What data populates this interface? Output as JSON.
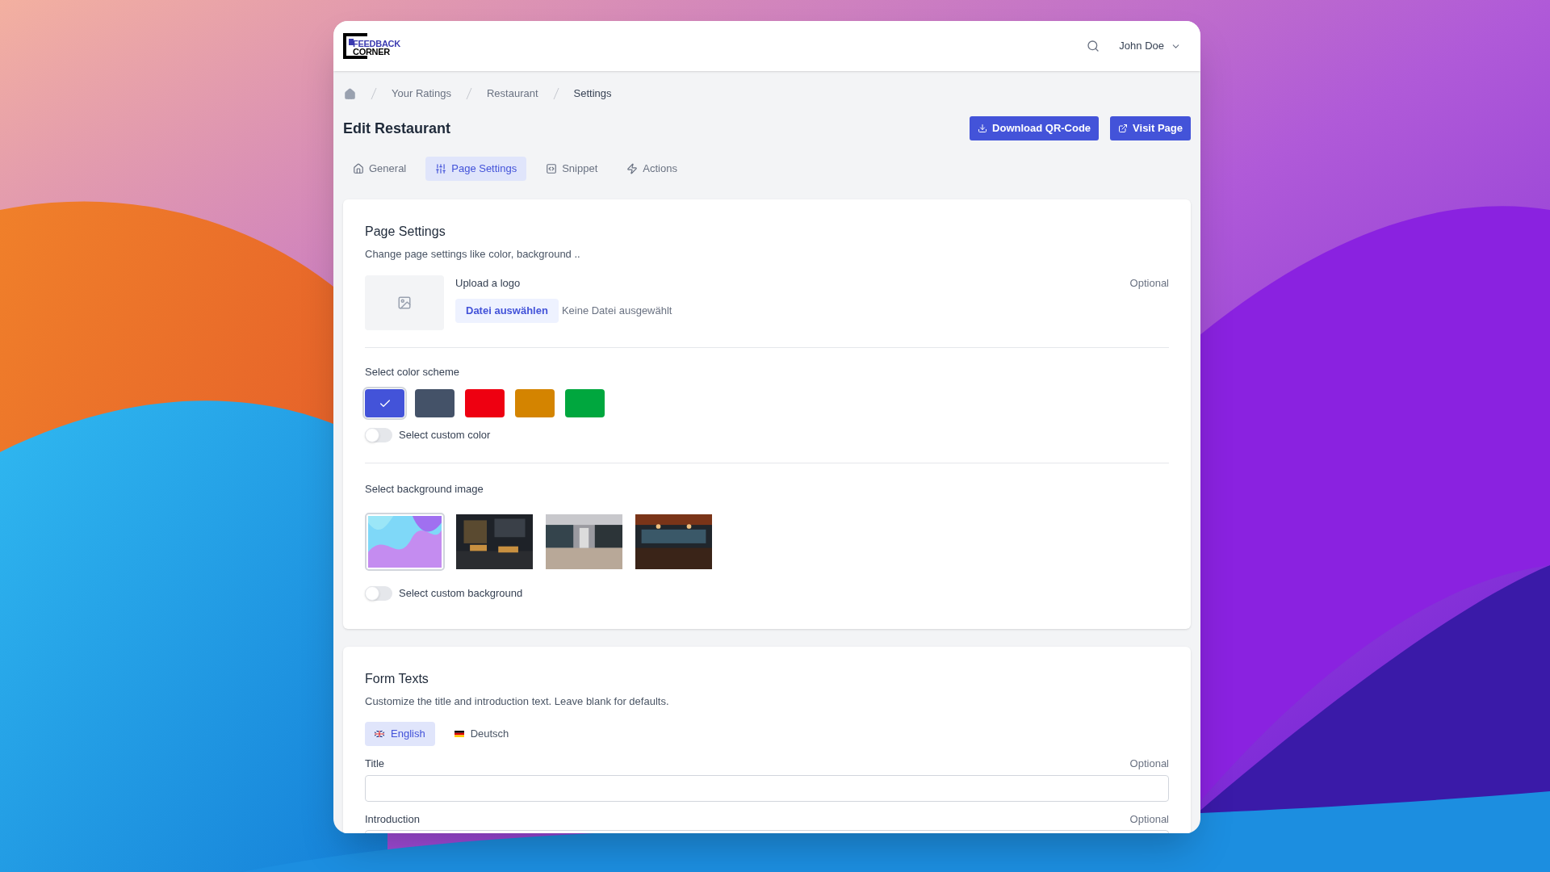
{
  "logo": {
    "line1": "FEEDBACK",
    "line2": "CORNER"
  },
  "user": {
    "name": "John Doe"
  },
  "breadcrumbs": [
    "Your Ratings",
    "Restaurant",
    "Settings"
  ],
  "page_title": "Edit Restaurant",
  "actions": [
    {
      "label": "Download QR-Code",
      "kind": "download"
    },
    {
      "label": "Visit Page",
      "kind": "external"
    }
  ],
  "tabs": [
    {
      "label": "General",
      "kind": "home",
      "selected": false
    },
    {
      "label": "Page Settings",
      "kind": "sliders",
      "selected": true
    },
    {
      "label": "Snippet",
      "kind": "code",
      "selected": false
    },
    {
      "label": "Actions",
      "kind": "bolt",
      "selected": false
    }
  ],
  "page_settings": {
    "title": "Page Settings",
    "description": "Change page settings like color, background ..",
    "logo_upload": {
      "label": "Upload a logo",
      "optional": "Optional",
      "button": "Datei auswählen",
      "status": "Keine Datei ausgewählt"
    },
    "color_scheme": {
      "label": "Select color scheme",
      "colors": [
        {
          "color": "#4353d9",
          "selected": true
        },
        {
          "color": "#445268",
          "selected": false
        },
        {
          "color": "#ee0011",
          "selected": false
        },
        {
          "color": "#d48400",
          "selected": false
        },
        {
          "color": "#00a73e",
          "selected": false
        }
      ]
    },
    "custom_color": {
      "label": "Select custom color",
      "on": false
    },
    "background": {
      "label": "Select background image",
      "images": [
        {
          "kind": "picture",
          "selected": true
        },
        {
          "kind": "picture",
          "selected": false
        },
        {
          "kind": "picture",
          "selected": false
        },
        {
          "kind": "picture",
          "selected": false
        }
      ]
    },
    "custom_background": {
      "label": "Select custom background",
      "on": false
    }
  },
  "form_texts": {
    "title": "Form Texts",
    "description": "Customize the title and introduction text. Leave blank for defaults.",
    "languages": [
      {
        "label": "English",
        "kind": "gb",
        "selected": true
      },
      {
        "label": "Deutsch",
        "kind": "de",
        "selected": false
      }
    ],
    "fields": [
      {
        "label": "Title",
        "optional": "Optional"
      },
      {
        "label": "Introduction",
        "optional": "Optional"
      }
    ]
  }
}
